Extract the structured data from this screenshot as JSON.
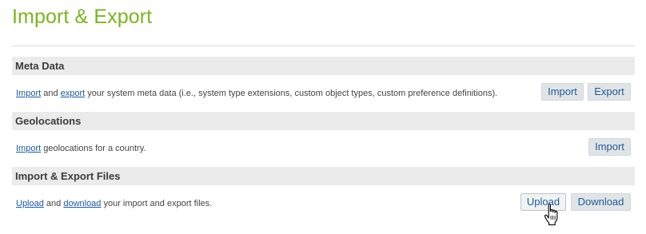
{
  "page": {
    "title": "Import & Export"
  },
  "sections": [
    {
      "header": "Meta Data",
      "link1": "Import",
      "and": " and ",
      "link2": "export",
      "rest": " your system meta data (i.e., system type extensions, custom object types, custom preference definitions).",
      "buttons": [
        "Import",
        "Export"
      ]
    },
    {
      "header": "Geolocations",
      "link1": "Import",
      "rest": " geolocations for a country.",
      "buttons": [
        "Import"
      ]
    },
    {
      "header": "Import & Export Files",
      "link1": "Upload",
      "and": " and ",
      "link2": "download",
      "rest": " your import and export files.",
      "buttons": [
        "Upload",
        "Download"
      ]
    }
  ],
  "colors": {
    "title": "#7ab51d",
    "section_bg": "#ebebeb",
    "link": "#1a5aa6",
    "button_bg": "#e1e4e6",
    "button_text": "#1e5c9a"
  },
  "cursor": {
    "icon": "hand-pointer-icon"
  }
}
